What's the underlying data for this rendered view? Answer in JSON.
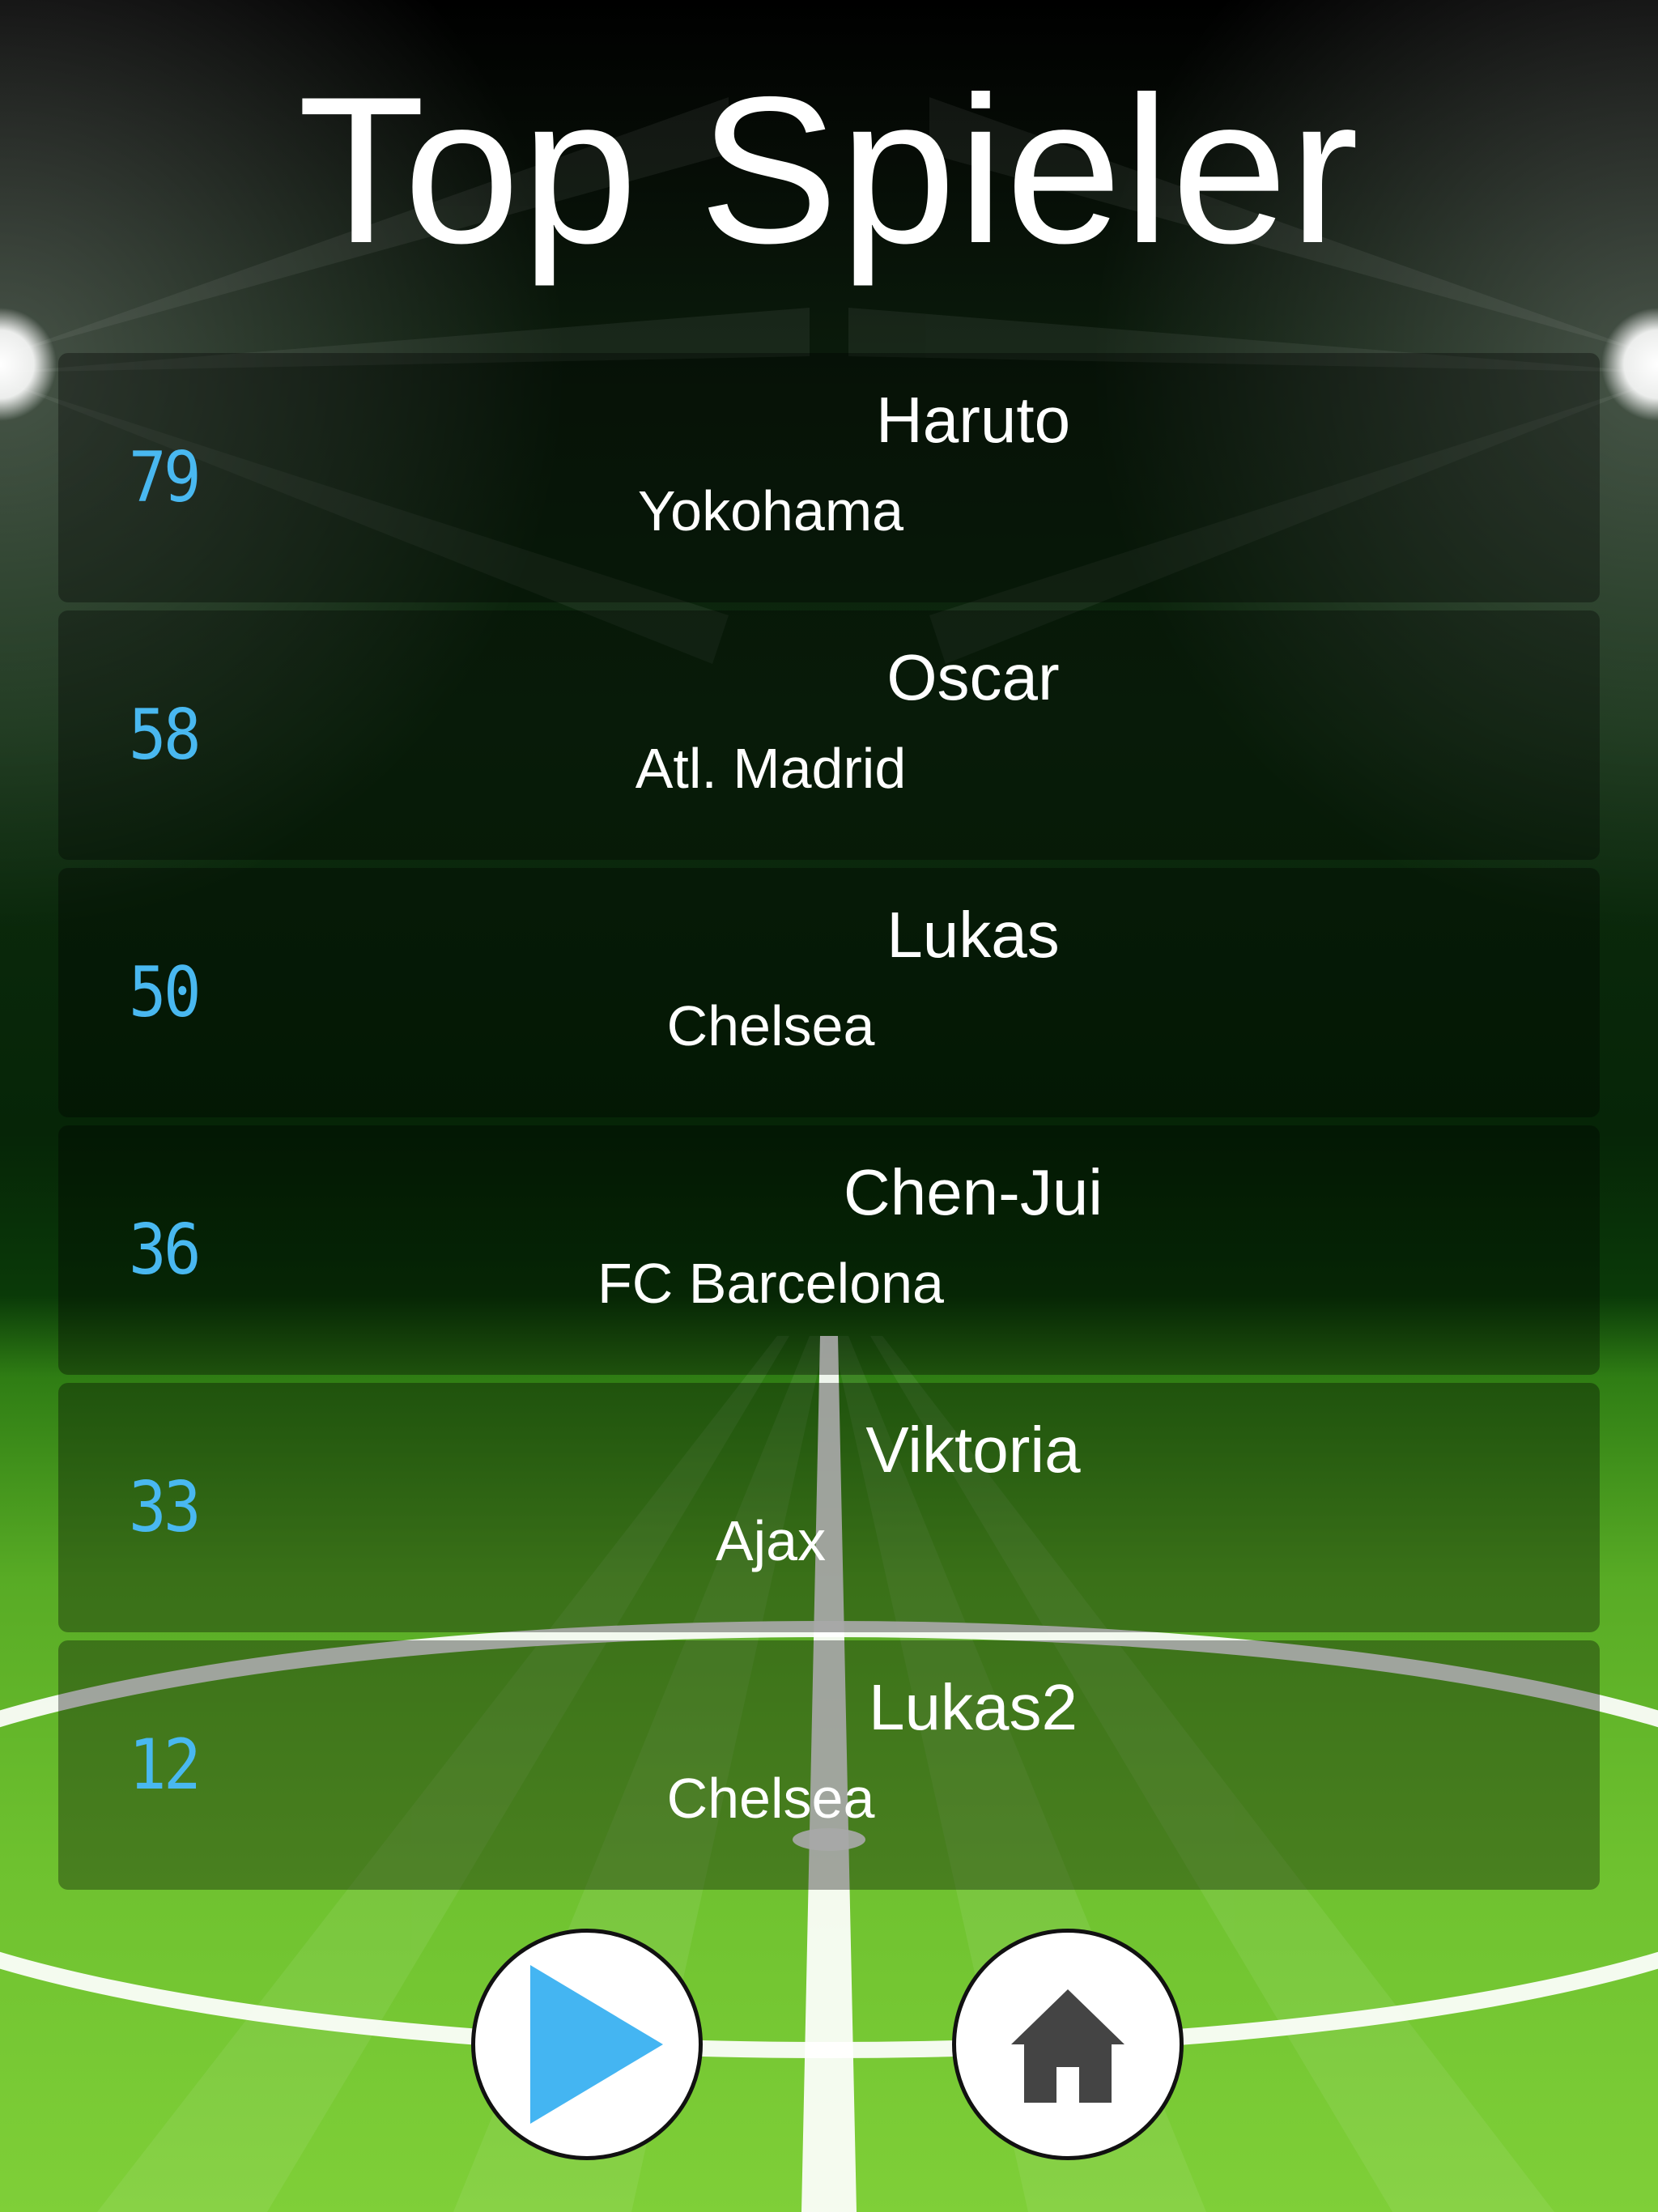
{
  "screen": {
    "title": "Top Spieler"
  },
  "leaderboard": [
    {
      "score": "79",
      "player": "Haruto",
      "team": "Yokohama"
    },
    {
      "score": "58",
      "player": "Oscar",
      "team": "Atl. Madrid"
    },
    {
      "score": "50",
      "player": "Lukas",
      "team": "Chelsea"
    },
    {
      "score": "36",
      "player": "Chen-Jui",
      "team": "FC Barcelona"
    },
    {
      "score": "33",
      "player": "Viktoria",
      "team": "Ajax"
    },
    {
      "score": "12",
      "player": "Lukas2",
      "team": "Chelsea"
    }
  ],
  "buttons": {
    "play": {
      "icon": "play-icon"
    },
    "home": {
      "icon": "home-icon"
    }
  },
  "colors": {
    "score": "#49b8f0",
    "play_icon": "#44b5f2",
    "home_icon": "#444444"
  }
}
